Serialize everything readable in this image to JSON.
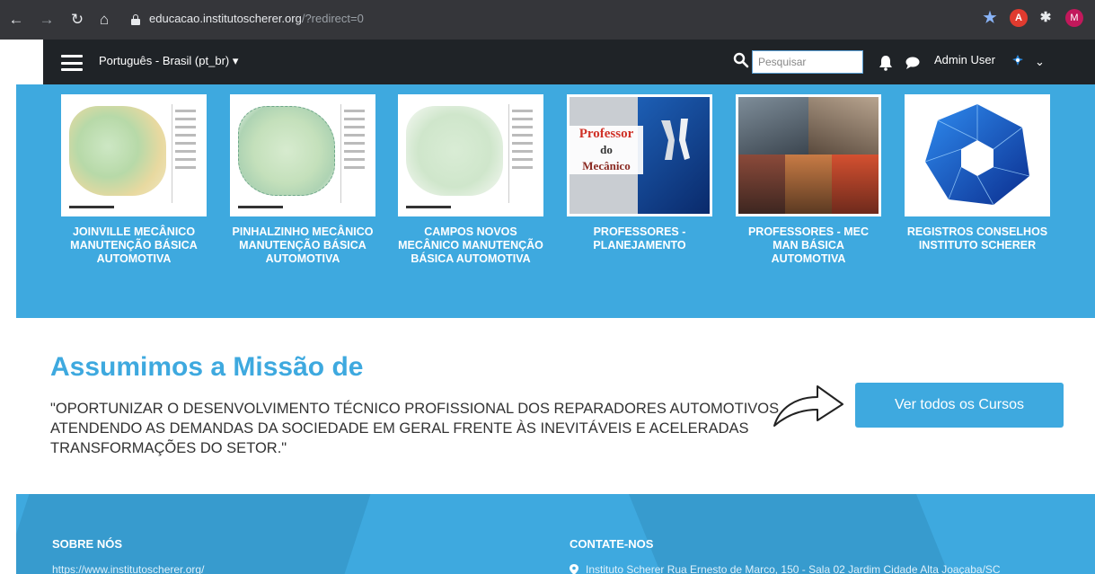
{
  "browser": {
    "url_host": "educacao.institutoscherer.org",
    "url_path": "/?redirect=0",
    "profile_initial": "M",
    "icons": [
      "back-arrow-icon",
      "forward-arrow-icon",
      "reload-icon",
      "home-icon",
      "lock-icon",
      "bookmark-star-icon",
      "pdf-extension-icon",
      "extensions-puzzle-icon",
      "profile-avatar"
    ]
  },
  "navbar": {
    "language": "Português - Brasil (pt_br)",
    "search_placeholder": "Pesquisar",
    "username": "Admin User",
    "icons": [
      "menu-icon",
      "search-icon",
      "bell-icon",
      "chat-icon",
      "user-avatar-icon",
      "chevron-down-icon"
    ]
  },
  "courses": [
    {
      "title": "JOINVILLE MECÂNICO MANUTENÇÃO BÁSICA AUTOMOTIVA",
      "thumb": "map-image"
    },
    {
      "title": "PINHALZINHO MECÂNICO MANUTENÇÃO BÁSICA AUTOMOTIVA",
      "thumb": "map-image"
    },
    {
      "title": "CAMPOS NOVOS MECÂNICO MANUTENÇÃO BÁSICA AUTOMOTIVA",
      "thumb": "map-image"
    },
    {
      "title": "PROFESSORES - PLANEJAMENTO",
      "thumb": "professor-do-mecanico-image",
      "thumb_text": [
        "Professor",
        "do",
        "Mecânico"
      ]
    },
    {
      "title": "PROFESSORES - MEC MAN BÁSICA AUTOMOTIVA",
      "thumb": "workshop-photo-collage"
    },
    {
      "title": "REGISTROS CONSELHOS INSTITUTO SCHERER",
      "thumb": "blue-network-logo-image"
    }
  ],
  "mission": {
    "title": "Assumimos a Missão de",
    "text": "\"OPORTUNIZAR O DESENVOLVIMENTO TÉCNICO PROFISSIONAL DOS REPARADORES AUTOMOTIVOS ATENDENDO AS DEMANDAS DA SOCIEDADE EM GERAL FRENTE ÀS INEVITÁVEIS E ACELERADAS TRANSFORMAÇÕES DO SETOR.\"",
    "cta_label": "Ver todos os Cursos"
  },
  "footer": {
    "about_heading": "SOBRE NÓS",
    "about_link": "https://www.institutoscherer.org/",
    "contact_heading": "CONTATE-NOS",
    "address": "Instituto Scherer Rua Ernesto de Marco, 150 - Sala 02 Jardim Cidade Alta Joaçaba/SC"
  },
  "colors": {
    "brand_blue": "#3ea9df",
    "navbar_dark": "#1f2327",
    "chrome_dark": "#35363a",
    "text_dark": "#333333"
  }
}
